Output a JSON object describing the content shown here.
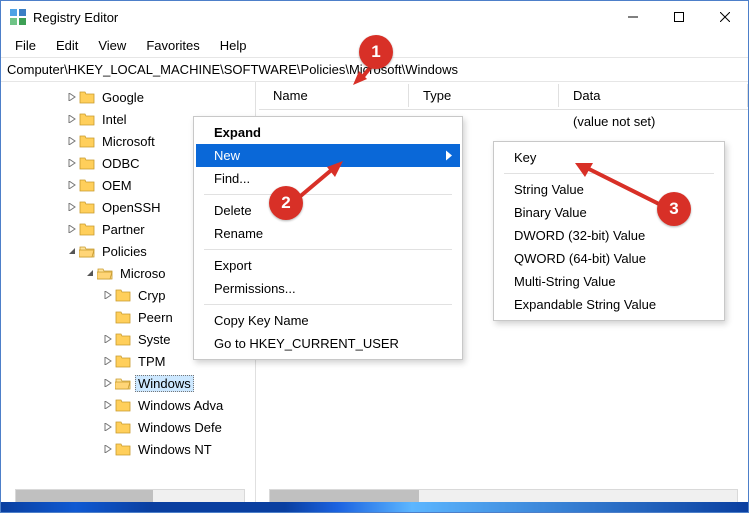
{
  "title": "Registry Editor",
  "menu": {
    "file": "File",
    "edit": "Edit",
    "view": "View",
    "favorites": "Favorites",
    "help": "Help"
  },
  "address": "Computer\\HKEY_LOCAL_MACHINE\\SOFTWARE\\Policies\\Microsoft\\Windows",
  "tree": {
    "items": [
      {
        "label": "Google",
        "depth": 1,
        "twisty": "closed",
        "folder": "closed",
        "selected": false
      },
      {
        "label": "Intel",
        "depth": 1,
        "twisty": "closed",
        "folder": "closed",
        "selected": false
      },
      {
        "label": "Microsoft",
        "depth": 1,
        "twisty": "closed",
        "folder": "closed",
        "selected": false
      },
      {
        "label": "ODBC",
        "depth": 1,
        "twisty": "closed",
        "folder": "closed",
        "selected": false
      },
      {
        "label": "OEM",
        "depth": 1,
        "twisty": "closed",
        "folder": "closed",
        "selected": false
      },
      {
        "label": "OpenSSH",
        "depth": 1,
        "twisty": "closed",
        "folder": "closed",
        "selected": false
      },
      {
        "label": "Partner",
        "depth": 1,
        "twisty": "closed",
        "folder": "closed",
        "selected": false
      },
      {
        "label": "Policies",
        "depth": 1,
        "twisty": "open",
        "folder": "open",
        "selected": false
      },
      {
        "label": "Microso",
        "depth": 2,
        "twisty": "open",
        "folder": "open",
        "selected": false
      },
      {
        "label": "Cryp",
        "depth": 3,
        "twisty": "closed",
        "folder": "closed",
        "selected": false
      },
      {
        "label": "Peern",
        "depth": 3,
        "twisty": "none",
        "folder": "closed",
        "selected": false
      },
      {
        "label": "Syste",
        "depth": 3,
        "twisty": "closed",
        "folder": "closed",
        "selected": false
      },
      {
        "label": "TPM",
        "depth": 3,
        "twisty": "closed",
        "folder": "closed",
        "selected": false
      },
      {
        "label": "Windows",
        "depth": 3,
        "twisty": "closed",
        "folder": "open",
        "selected": true
      },
      {
        "label": "Windows Adva",
        "depth": 3,
        "twisty": "closed",
        "folder": "closed",
        "selected": false
      },
      {
        "label": "Windows Defe",
        "depth": 3,
        "twisty": "closed",
        "folder": "closed",
        "selected": false
      },
      {
        "label": "Windows NT",
        "depth": 3,
        "twisty": "closed",
        "folder": "closed",
        "selected": false
      }
    ]
  },
  "list": {
    "columns": {
      "name": "Name",
      "type": "Type",
      "data": "Data"
    },
    "rows": [
      {
        "name": "",
        "type": "",
        "data": "(value not set)"
      }
    ]
  },
  "context_menu": {
    "expand": "Expand",
    "new": "New",
    "find": "Find...",
    "delete": "Delete",
    "rename": "Rename",
    "export": "Export",
    "permissions": "Permissions...",
    "copy_key_name": "Copy Key Name",
    "goto_hkcu": "Go to HKEY_CURRENT_USER"
  },
  "submenu_new": {
    "key": "Key",
    "string_value": "String Value",
    "binary_value": "Binary Value",
    "dword": "DWORD (32-bit) Value",
    "qword": "QWORD (64-bit) Value",
    "multi_string": "Multi-String Value",
    "expand_string": "Expandable String Value"
  },
  "callouts": {
    "c1": "1",
    "c2": "2",
    "c3": "3"
  }
}
